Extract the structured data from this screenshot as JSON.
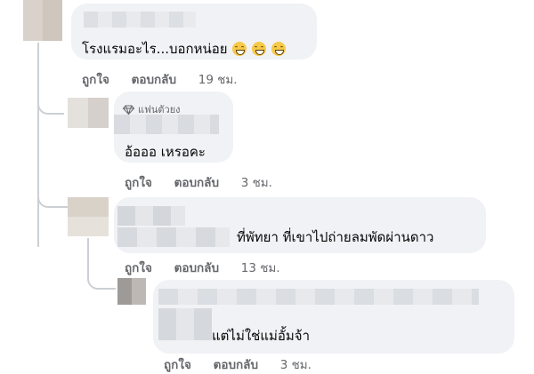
{
  "comments": [
    {
      "text": "โรงแรมอะไร...บอกหน่อย",
      "emoji_count": 3,
      "emoji_icon": "grinning-face-emoji",
      "actions": {
        "like": "ถูกใจ",
        "reply": "ตอบกลับ",
        "time": "19 ชม."
      }
    },
    {
      "badge": "แฟนตัวยง",
      "text": "อ้อออ เหรอคะ",
      "actions": {
        "like": "ถูกใจ",
        "reply": "ตอบกลับ",
        "time": "3 ชม."
      }
    },
    {
      "text": "ที่พัทยา ที่เขาไปถ่ายลมพัดผ่านดาว",
      "actions": {
        "like": "ถูกใจ",
        "reply": "ตอบกลับ",
        "time": "13 ชม."
      }
    },
    {
      "text": "แต่ไม่ใช่แม่อั้มจ้า",
      "actions": {
        "like": "ถูกใจ",
        "reply": "ตอบกลับ",
        "time": "3 ชม."
      }
    }
  ],
  "colors": {
    "bubble": "#f0f2f5",
    "secondary_text": "#65676b",
    "thread_line": "#ccd0d5"
  }
}
